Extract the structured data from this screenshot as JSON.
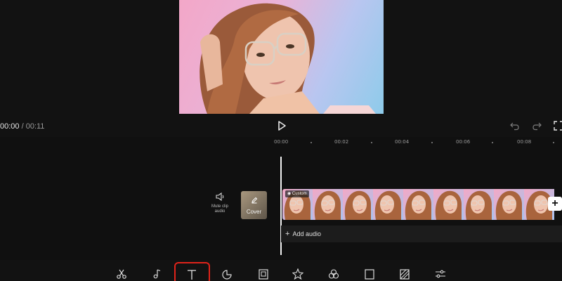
{
  "preview": {
    "current_time": "00:00",
    "separator": " / ",
    "total_time": "00:11"
  },
  "timeline": {
    "ruler_labels": [
      "00:00",
      "00:02",
      "00:04",
      "00:06",
      "00:08"
    ],
    "mute_clip_label": "Mute clip audio",
    "cover_label": "Cover",
    "custom_badge": "Custom",
    "add_audio_label": "Add audio",
    "add_clip_symbol": "+",
    "thumb_count": 9
  },
  "toolbar": {
    "tools": [
      "edit-icon",
      "audio-icon",
      "text-icon",
      "sticker-icon",
      "overlay-icon",
      "effects-icon",
      "filters-icon",
      "ratio-icon",
      "background-icon",
      "adjust-icon"
    ],
    "selected_tool": "text-icon"
  },
  "colors": {
    "highlight": "#e0231a",
    "background": "#121212"
  }
}
